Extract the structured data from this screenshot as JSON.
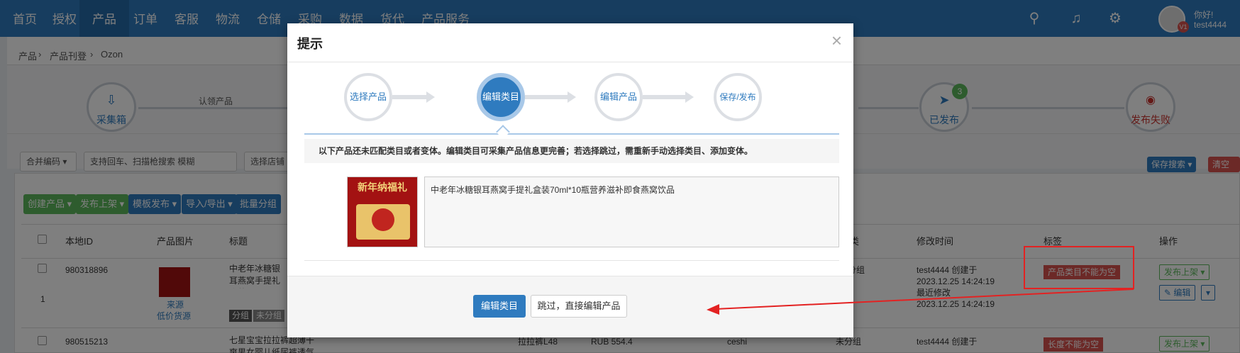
{
  "nav": {
    "items": [
      "首页",
      "授权",
      "产品",
      "订单",
      "客服",
      "物流",
      "仓储",
      "采购",
      "数据",
      "货代",
      "产品服务"
    ],
    "active": "产品",
    "user_greeting": "你好!",
    "username": "test4444",
    "vip_badge": "V1"
  },
  "breadcrumb": [
    "产品",
    "产品刊登",
    "Ozon"
  ],
  "bg_steps": {
    "collect": "采集箱",
    "claim": "认领产品",
    "published": "已发布",
    "published_count": "3",
    "failed": "发布失败"
  },
  "filter": {
    "merge_code": "合并编码",
    "search_placeholder": "支持回车、扫描枪搜索",
    "fuzzy": "模糊",
    "store_select": "选择店铺",
    "save_search": "保存搜索",
    "clear": "清空"
  },
  "toolbar": {
    "create": "创建产品",
    "publish": "发布上架",
    "template_publish": "模板发布",
    "import_export": "导入/导出",
    "batch_group": "批量分组"
  },
  "table": {
    "headers": {
      "local_id": "本地ID",
      "image": "产品图片",
      "title": "标题",
      "category": "分类",
      "modified": "修改时间",
      "tag": "标签",
      "action": "操作"
    },
    "rows": [
      {
        "index": "1",
        "id": "980318896",
        "title": "中老年冰糖银耳燕窝手提礼盒装70ml*10瓶营养滋补即食燕窝饮品",
        "source": "来源",
        "low_price": "低价货源",
        "group_label": "分组",
        "group_value": "未分组",
        "category": "分组",
        "creator": "test4444 创建于",
        "created": "2023.12.25 14:24:19",
        "last_modified_label": "最近修改",
        "modified": "2023.12.25 14:24:19",
        "tag": "产品类目不能为空",
        "action_publish": "发布上架",
        "action_edit": "编辑"
      },
      {
        "id": "980515213",
        "title": "七星宝宝拉拉裤超薄干爽男女婴儿纸尿裤透气不起坨尿不湿厂家直销",
        "sku": "拉拉裤L48",
        "price": "RUB 554.4",
        "store": "ceshi",
        "category": "未分组",
        "creator": "test4444 创建于",
        "tag": "长度不能为空",
        "action_publish": "发布上架"
      }
    ]
  },
  "modal": {
    "title": "提示",
    "close": "×",
    "steps": [
      "选择产品",
      "编辑类目",
      "编辑产品",
      "保存/发布"
    ],
    "active_step": 1,
    "notice": "以下产品还未匹配类目或者变体。编辑类目可采集产品信息更完善；若选择跳过，需重新手动选择类目、添加变体。",
    "product_title": "中老年冰糖银耳燕窝手提礼盒装70ml*10瓶营养滋补即食燕窝饮品",
    "thumb_text": "新年纳福礼",
    "edit_category_button": "编辑类目",
    "skip_button": "跳过，直接编辑产品"
  },
  "colors": {
    "primary": "#2f7bbf",
    "success": "#5cb85c",
    "danger": "#d9534f",
    "annotation": "#e32222"
  }
}
